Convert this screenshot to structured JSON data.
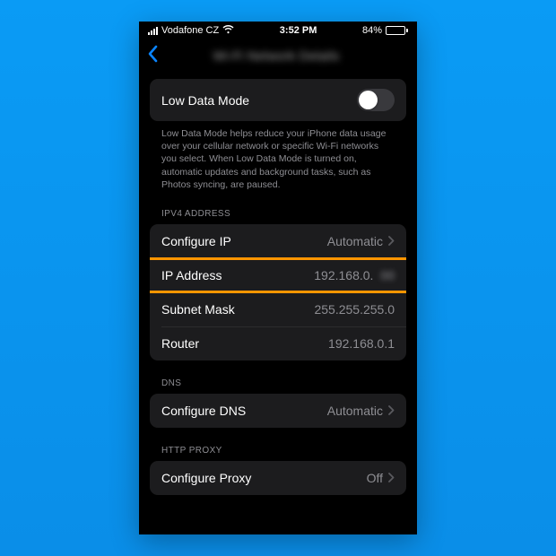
{
  "status": {
    "carrier": "Vodafone CZ",
    "time": "3:52 PM",
    "battery": "84%"
  },
  "nav": {
    "title_hint": "Wi-Fi Network Details"
  },
  "low_data": {
    "label": "Low Data Mode",
    "description": "Low Data Mode helps reduce your iPhone data usage over your cellular network or specific Wi-Fi networks you select. When Low Data Mode is turned on, automatic updates and background tasks, such as Photos syncing, are paused."
  },
  "sections": {
    "ipv4": {
      "header": "IPV4 ADDRESS",
      "configure_ip": {
        "label": "Configure IP",
        "value": "Automatic"
      },
      "ip_address": {
        "label": "IP Address",
        "value": "192.168.0.",
        "blurred_suffix": "00"
      },
      "subnet_mask": {
        "label": "Subnet Mask",
        "value": "255.255.255.0"
      },
      "router": {
        "label": "Router",
        "value": "192.168.0.1"
      }
    },
    "dns": {
      "header": "DNS",
      "configure_dns": {
        "label": "Configure DNS",
        "value": "Automatic"
      }
    },
    "proxy": {
      "header": "HTTP PROXY",
      "configure_proxy": {
        "label": "Configure Proxy",
        "value": "Off"
      }
    }
  },
  "colors": {
    "highlight": "#ff9500",
    "accent": "#0a84ff",
    "battery_fill": "#ffd60a"
  }
}
